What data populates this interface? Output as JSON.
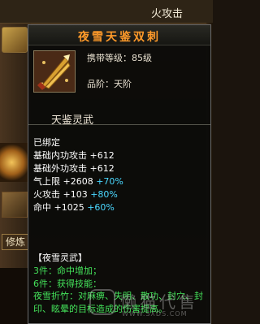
{
  "background": {
    "top_right_text": "火攻击",
    "cultivate_button": "修炼"
  },
  "tooltip": {
    "title": "夜雪天鉴双刺",
    "required_level": "携带等级：85级",
    "grade": "品阶：天阶",
    "category": "天鉴灵武",
    "bound": "已绑定",
    "stats": [
      {
        "name": "基础内功攻击",
        "value": "+612",
        "bonus": "",
        "pct": ""
      },
      {
        "name": "基础外功攻击",
        "value": "+612",
        "bonus": "",
        "pct": ""
      },
      {
        "name": "气上限",
        "value": "+2608",
        "bonus": "",
        "pct": "+70%"
      },
      {
        "name": "火攻击",
        "value": "+103",
        "bonus": "",
        "pct": "+80%"
      },
      {
        "name": "命中",
        "value": "+1025",
        "bonus": "",
        "pct": "+60%"
      }
    ],
    "set": {
      "title": "【夜雪灵武】",
      "tier3": "3件：命中增加；",
      "tier6": "6件：获得技能：",
      "effect": "夜雪折竹：对麻痹、失明、散功、封穴、封印、眩晕的目标造成的伤害提高。"
    }
  },
  "watermark": {
    "text": "懒猫代售",
    "url": "WWW.SXDS.COM"
  },
  "colors": {
    "title": "#ff9a2a",
    "stat_bonus": "#4ad8ff",
    "set_text": "#44e25a"
  }
}
